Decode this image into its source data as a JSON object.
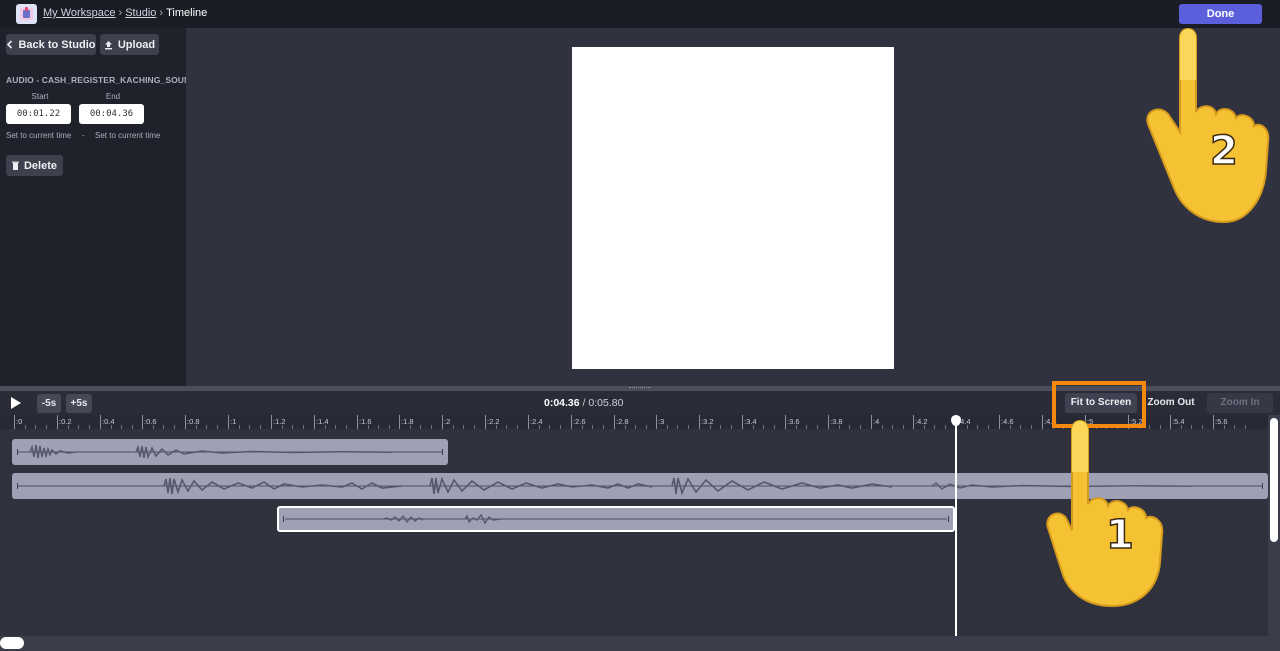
{
  "header": {
    "breadcrumb": [
      "My Workspace",
      "Studio",
      "Timeline"
    ],
    "done_label": "Done"
  },
  "sidebar": {
    "back_label": "Back to Studio",
    "upload_label": "Upload",
    "asset_name": "AUDIO - CASH_REGISTER_KACHING_SOUND...",
    "start_label": "Start",
    "end_label": "End",
    "start_value": "00:01.22",
    "end_value": "00:04.36",
    "set_current_start": "Set to current time",
    "set_sep": "-",
    "set_current_end": "Set to current time",
    "delete_label": "Delete"
  },
  "timeline": {
    "minus_label": "-5s",
    "plus_label": "+5s",
    "current_time": "0:04.36",
    "total_time": " / 0:05.80",
    "fit_label": "Fit to Screen",
    "zoom_out_label": "Zoom Out",
    "zoom_in_label": "Zoom In",
    "ruler_ticks": [
      ":0",
      ":0.2",
      ":0.4",
      ":0.6",
      ":0.8",
      ":1",
      ":1.2",
      ":1.4",
      ":1.6",
      ":1.8",
      ":2",
      ":2.2",
      ":2.4",
      ":2.6",
      ":2.8",
      ":3",
      ":3.2",
      ":3.4",
      ":3.6",
      ":3.8",
      ":4",
      ":4.2",
      ":4.4",
      ":4.6",
      ":4.8",
      ":5",
      ":5.2",
      ":5.4",
      ":5.6"
    ],
    "playhead_seconds": 4.36,
    "duration_seconds": 5.8
  },
  "annotations": {
    "hand_1": "1",
    "hand_2": "2"
  },
  "colors": {
    "accent": "#5b5fdc",
    "highlight": "#f5890e",
    "clip": "#9ea1b4"
  }
}
